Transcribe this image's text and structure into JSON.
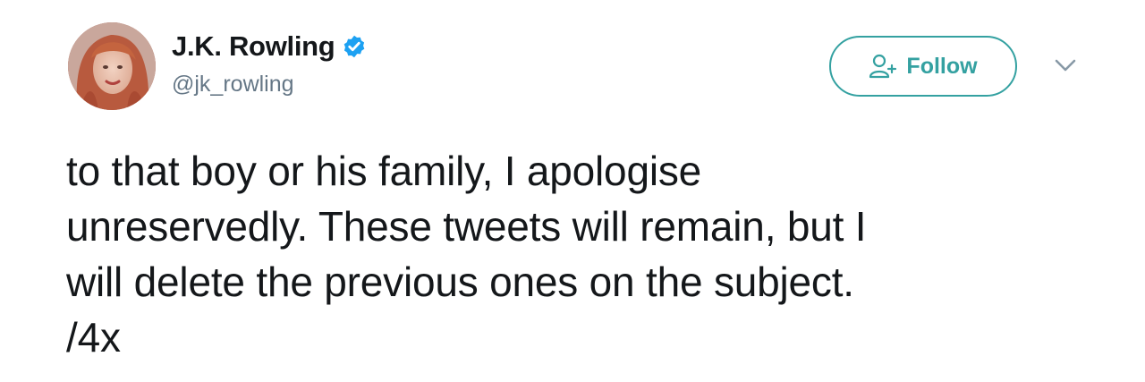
{
  "author": {
    "display_name": "J.K. Rowling",
    "handle": "@jk_rowling",
    "verified": true,
    "verified_color": "#1da1f2"
  },
  "actions": {
    "follow_label": "Follow",
    "follow_color": "#34a1a1",
    "follow_icon": "add-person-icon",
    "menu_icon": "chevron-down-icon"
  },
  "tweet": {
    "lines": [
      "to that boy or his family, I apologise",
      "unreserved ly. These tweets will remain, but I",
      "will delete the previous ones on the subject.",
      "/4x"
    ]
  }
}
